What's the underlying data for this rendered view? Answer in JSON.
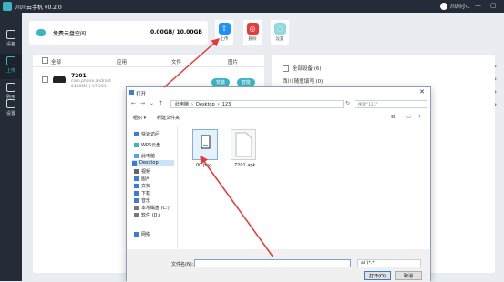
{
  "app": {
    "title": "川川云手机 v0.2.0",
    "user_name": "川川小..",
    "minimize": "—",
    "maximize": "▢"
  },
  "sidebar": {
    "items": [
      {
        "label": "设备"
      },
      {
        "label": "上传"
      },
      {
        "label": "购买"
      },
      {
        "label": "设置"
      }
    ]
  },
  "storage": {
    "label": "免费云盘空间",
    "value": "0.00GB/ 10.00GB"
  },
  "toolbar": {
    "upload_label": "上传",
    "delete_label": "删除",
    "setting_label": "设置"
  },
  "tabs": [
    "全部",
    "应用",
    "文件",
    "图片"
  ],
  "device": {
    "name": "7201",
    "sub1": "com.phone.android",
    "sub2": "6438MB | V7.201",
    "install_label": "安装",
    "update_label": "智能"
  },
  "right_panel": {
    "all_devices_label": "全部设备 (6)",
    "group_label": "西川 随意填写 (0)"
  },
  "dialog": {
    "title": "打开",
    "path": [
      "此电脑",
      "Desktop",
      "123"
    ],
    "search_placeholder": "搜索\"123\"",
    "organize_label": "组织 ▾",
    "new_folder_label": "新建文件夹",
    "tree": [
      "快速访问",
      "WPS云盘",
      "此电脑",
      "Desktop",
      "视频",
      "图片",
      "文档",
      "下载",
      "音乐",
      "本地磁盘 (C:)",
      "软件 (D:)",
      "网络"
    ],
    "files": [
      {
        "name": "00.png"
      },
      {
        "name": "7201.apk"
      }
    ],
    "filename_label": "文件名(N):",
    "filetype": "all (*.*)",
    "open_label": "打开(O)",
    "cancel_label": "取消"
  },
  "colors": {
    "accent": "#3bb5c3",
    "upload": "#1e90ff",
    "delete": "#e83a3a",
    "arrow": "#e53935"
  }
}
